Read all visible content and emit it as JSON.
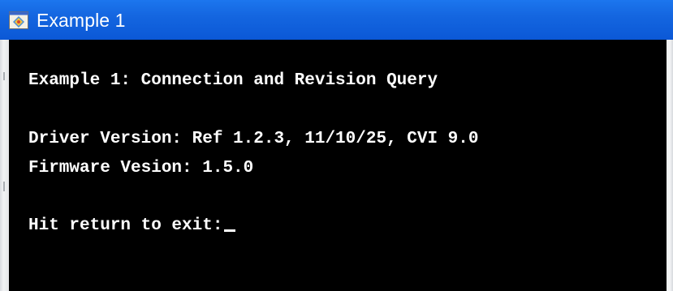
{
  "window": {
    "title": "Example 1",
    "icon": "console-app-icon"
  },
  "console": {
    "lines": [
      "Example 1: Connection and Revision Query",
      "Driver Version: Ref 1.2.3, 11/10/25, CVI 9.0",
      "Firmware Vesion: 1.5.0",
      "Hit return to exit:"
    ],
    "cursor": "_"
  },
  "colors": {
    "titlebar": "#1466e0",
    "console_bg": "#000000",
    "console_text": "#ffffff"
  }
}
